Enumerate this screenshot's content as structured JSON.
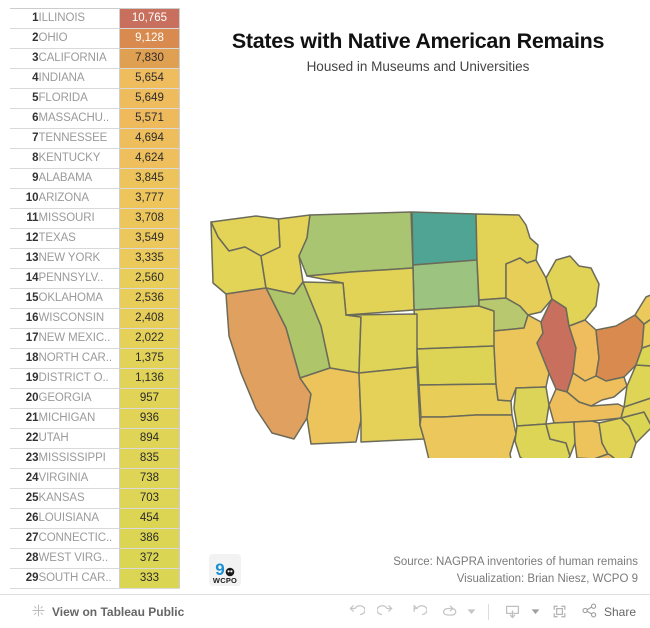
{
  "header": {
    "title": "States with Native American Remains",
    "subtitle": "Housed in Museums and Universities"
  },
  "table": {
    "rows": [
      {
        "rank": "1",
        "state": "ILLINOIS",
        "value": "10,765",
        "color": "#c8705d",
        "text_color": "#ffffff"
      },
      {
        "rank": "2",
        "state": "OHIO",
        "value": "9,128",
        "color": "#d98b4f",
        "text_color": "#ffffff"
      },
      {
        "rank": "3",
        "state": "CALIFORNIA",
        "value": "7,830",
        "color": "#e0a052",
        "text_color": "#2b2b2b"
      },
      {
        "rank": "4",
        "state": "INDIANA",
        "value": "5,654",
        "color": "#f0bd5e",
        "text_color": "#2b2b2b"
      },
      {
        "rank": "5",
        "state": "FLORIDA",
        "value": "5,649",
        "color": "#eebb5d",
        "text_color": "#2b2b2b"
      },
      {
        "rank": "6",
        "state": "MASSACHU..",
        "value": "5,571",
        "color": "#eeba5c",
        "text_color": "#2b2b2b"
      },
      {
        "rank": "7",
        "state": "TENNESSEE",
        "value": "4,694",
        "color": "#eebe5c",
        "text_color": "#2b2b2b"
      },
      {
        "rank": "8",
        "state": "KENTUCKY",
        "value": "4,624",
        "color": "#eebf5c",
        "text_color": "#2b2b2b"
      },
      {
        "rank": "9",
        "state": "ALABAMA",
        "value": "3,845",
        "color": "#edc45b",
        "text_color": "#2b2b2b"
      },
      {
        "rank": "10",
        "state": "ARIZONA",
        "value": "3,777",
        "color": "#edc55b",
        "text_color": "#2b2b2b"
      },
      {
        "rank": "11",
        "state": "MISSOURI",
        "value": "3,708",
        "color": "#ecc65b",
        "text_color": "#2b2b2b"
      },
      {
        "rank": "12",
        "state": "TEXAS",
        "value": "3,549",
        "color": "#ecc75b",
        "text_color": "#2b2b2b"
      },
      {
        "rank": "13",
        "state": "NEW YORK",
        "value": "3,335",
        "color": "#ebc95b",
        "text_color": "#2b2b2b"
      },
      {
        "rank": "14",
        "state": "PENNSYLV..",
        "value": "2,560",
        "color": "#e8cd59",
        "text_color": "#2b2b2b"
      },
      {
        "rank": "15",
        "state": "OKLAHOMA",
        "value": "2,536",
        "color": "#e8cd59",
        "text_color": "#2b2b2b"
      },
      {
        "rank": "16",
        "state": "WISCONSIN",
        "value": "2,408",
        "color": "#e7ce59",
        "text_color": "#2b2b2b"
      },
      {
        "rank": "17",
        "state": "NEW MEXIC..",
        "value": "2,022",
        "color": "#e5d058",
        "text_color": "#2b2b2b"
      },
      {
        "rank": "18",
        "state": "NORTH CAR..",
        "value": "1,375",
        "color": "#e2d257",
        "text_color": "#2b2b2b"
      },
      {
        "rank": "19",
        "state": "DISTRICT O..",
        "value": "1,136",
        "color": "#e1d357",
        "text_color": "#2b2b2b"
      },
      {
        "rank": "20",
        "state": "GEORGIA",
        "value": "957",
        "color": "#e0d356",
        "text_color": "#2b2b2b"
      },
      {
        "rank": "21",
        "state": "MICHIGAN",
        "value": "936",
        "color": "#e0d356",
        "text_color": "#2b2b2b"
      },
      {
        "rank": "22",
        "state": "UTAH",
        "value": "894",
        "color": "#dfd456",
        "text_color": "#2b2b2b"
      },
      {
        "rank": "23",
        "state": "MISSISSIPPI",
        "value": "835",
        "color": "#dfd456",
        "text_color": "#2b2b2b"
      },
      {
        "rank": "24",
        "state": "VIRGINIA",
        "value": "738",
        "color": "#ded455",
        "text_color": "#2b2b2b"
      },
      {
        "rank": "25",
        "state": "KANSAS",
        "value": "703",
        "color": "#ded455",
        "text_color": "#2b2b2b"
      },
      {
        "rank": "26",
        "state": "LOUISIANA",
        "value": "454",
        "color": "#dcd554",
        "text_color": "#2b2b2b"
      },
      {
        "rank": "27",
        "state": "CONNECTIC..",
        "value": "386",
        "color": "#dcd554",
        "text_color": "#2b2b2b"
      },
      {
        "rank": "28",
        "state": "WEST VIRG..",
        "value": "372",
        "color": "#dbd554",
        "text_color": "#2b2b2b"
      },
      {
        "rank": "29",
        "state": "SOUTH CAR..",
        "value": "333",
        "color": "#dbd554",
        "text_color": "#2b2b2b"
      }
    ]
  },
  "caption": {
    "source": "Source: NAGPRA inventories of human remains",
    "visualization": "Visualization: Brian Niesz, WCPO 9",
    "logo_text": "WCPO",
    "logo_number": "9"
  },
  "toolbar": {
    "tableau_link": "View on Tableau Public",
    "share_label": "Share",
    "icons": {
      "tableau": "tableau-logo-icon",
      "undo": "undo-icon",
      "redo": "redo-icon",
      "revert": "revert-icon",
      "refresh": "refresh-icon",
      "refresh_caret": "chevron-down-icon",
      "download": "download-icon",
      "download_caret": "chevron-down-icon",
      "fullscreen": "fullscreen-icon",
      "share": "share-icon"
    }
  },
  "chart_data": {
    "type": "map",
    "title": "States with Native American Remains",
    "subtitle": "Housed in Museums and Universities",
    "measure": "Native American remains housed in museums and universities",
    "colormap": "red-orange-yellow-green-teal (descending value)",
    "legend": "none shown",
    "categories": [
      "ILLINOIS",
      "OHIO",
      "CALIFORNIA",
      "INDIANA",
      "FLORIDA",
      "MASSACHUSETTS",
      "TENNESSEE",
      "KENTUCKY",
      "ALABAMA",
      "ARIZONA",
      "MISSOURI",
      "TEXAS",
      "NEW YORK",
      "PENNSYLVANIA",
      "OKLAHOMA",
      "WISCONSIN",
      "NEW MEXICO",
      "NORTH CAROLINA",
      "DISTRICT OF COLUMBIA",
      "GEORGIA",
      "MICHIGAN",
      "UTAH",
      "MISSISSIPPI",
      "VIRGINIA",
      "KANSAS",
      "LOUISIANA",
      "CONNECTICUT",
      "WEST VIRGINIA",
      "SOUTH CAROLINA"
    ],
    "values": [
      10765,
      9128,
      7830,
      5654,
      5649,
      5571,
      4694,
      4624,
      3845,
      3777,
      3708,
      3549,
      3335,
      2560,
      2536,
      2408,
      2022,
      1375,
      1136,
      957,
      936,
      894,
      835,
      738,
      703,
      454,
      386,
      372,
      333
    ],
    "state_colors": {
      "WA": "#e3d457",
      "OR": "#e2d456",
      "CA": "#e0a05f",
      "NV": "#aec56a",
      "ID": "#e4d357",
      "MT": "#a9c572",
      "WY": "#e2d357",
      "UT": "#dcd35a",
      "AZ": "#edc45b",
      "CO": "#dfd458",
      "NM": "#e5d058",
      "ND": "#4fa493",
      "SD": "#9cc37f",
      "NE": "#e1d357",
      "KS": "#ddd456",
      "OK": "#e8cd59",
      "TX": "#ecc75b",
      "MN": "#e2d357",
      "IA": "#b7c86e",
      "MO": "#ecc65b",
      "AR": "#dcd458",
      "LA": "#ddd556",
      "WI": "#e7ce59",
      "IL": "#c8705d",
      "MI": "#e0d356",
      "IN": "#f0bd5e",
      "OH": "#d98b4f",
      "KY": "#eebf5c",
      "TN": "#eebe5c",
      "MS": "#dfd456",
      "AL": "#edc45b",
      "GA": "#e0d356",
      "FL": "#eebb5d",
      "SC": "#dbd554",
      "NC": "#e2d257",
      "VA": "#ded455",
      "WV": "#dbd554",
      "MD": "#dcd554",
      "DE": "#dcd554",
      "DC": "#e1d357",
      "PA": "#e8cd59",
      "NJ": "#5fb08e",
      "NY": "#ebc95b",
      "CT": "#dcd554",
      "RI": "#e0d356",
      "MA": "#eeba5c",
      "VT": "#63b18f",
      "NH": "#dcd554",
      "ME": "#5fb08e"
    }
  }
}
